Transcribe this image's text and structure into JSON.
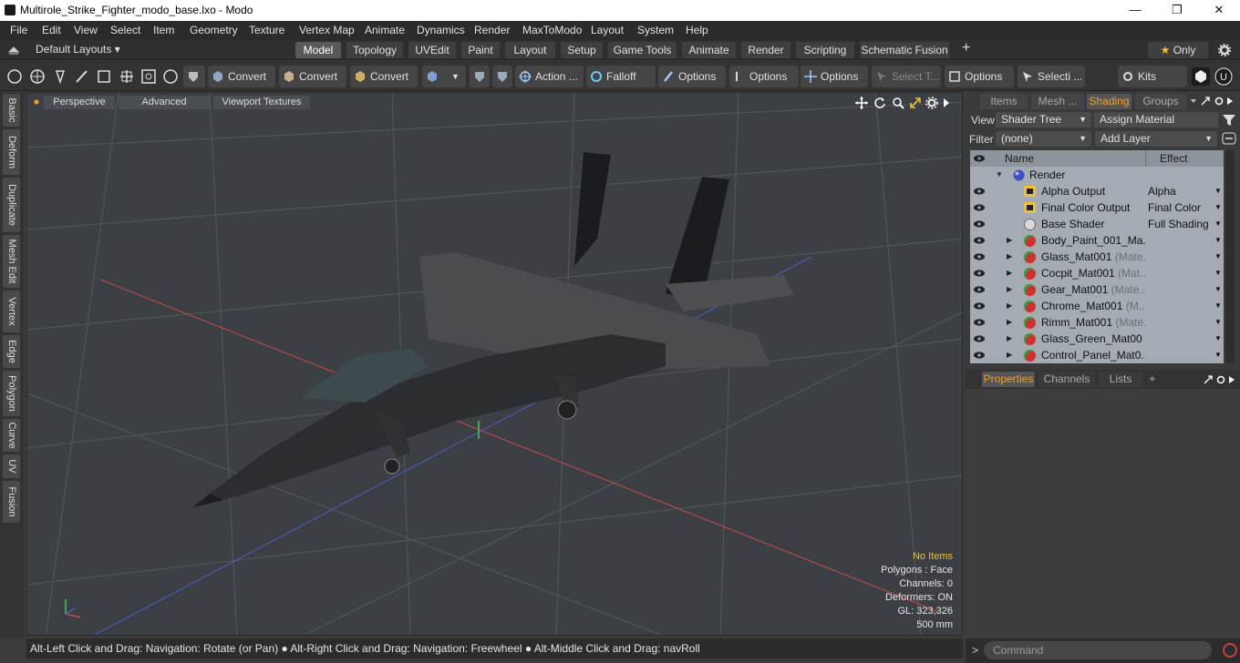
{
  "window": {
    "title": "Multirole_Strike_Fighter_modo_base.lxo - Modo",
    "minimize": "—",
    "maximize": "❐",
    "close": "✕"
  },
  "menu": [
    "File",
    "Edit",
    "View",
    "Select",
    "Item",
    "Geometry",
    "Texture",
    "Vertex Map",
    "Animate",
    "Dynamics",
    "Render",
    "MaxToModo",
    "Layout",
    "System",
    "Help"
  ],
  "layoutbar": {
    "layouts_label": "Default Layouts",
    "tabs": [
      "Model",
      "Topology",
      "UVEdit",
      "Paint",
      "Layout",
      "Setup",
      "Game Tools",
      "Animate",
      "Render",
      "Scripting",
      "Schematic Fusion"
    ],
    "active_tab": "Model",
    "plus": "+",
    "only_label": "Only",
    "star": "★"
  },
  "toolbar": {
    "convert1": "Convert",
    "convert2": "Convert",
    "convert3": "Convert",
    "action": "Action ...",
    "falloff": "Falloff",
    "options1": "Options",
    "options2": "Options",
    "options3": "Options",
    "select_t": "Select T...",
    "options4": "Options",
    "selecti": "Selecti ...",
    "kits": "Kits"
  },
  "lefttabs": [
    "Basic",
    "Deform",
    "Duplicate",
    "Mesh Edit",
    "Vertex",
    "Edge",
    "Polygon",
    "Curve",
    "UV",
    "Fusion"
  ],
  "viewport": {
    "perspective": "Perspective",
    "advanced": "Advanced",
    "textures": "Viewport Textures",
    "info": {
      "items": "No Items",
      "polygons": "Polygons : Face",
      "channels": "Channels: 0",
      "deformers": "Deformers: ON",
      "gl": "GL: 323,326",
      "scale": "500 mm"
    }
  },
  "status": "Alt-Left Click and Drag: Navigation: Rotate (or Pan) ● Alt-Right Click and Drag: Navigation: Freewheel ● Alt-Middle Click and Drag: navRoll",
  "rightpanel": {
    "tabs": [
      "Items",
      "Mesh ...",
      "Shading",
      "Groups"
    ],
    "active_tab": "Shading",
    "view_label": "View",
    "view_value": "Shader Tree",
    "assign_material": "Assign Material",
    "filter_label": "Filter",
    "filter_value": "(none)",
    "add_layer": "Add Layer",
    "col_name": "Name",
    "col_effect": "Effect",
    "rows": [
      {
        "name": "Render",
        "sub": "",
        "effect": ""
      },
      {
        "name": "Alpha Output",
        "sub": "",
        "effect": "Alpha"
      },
      {
        "name": "Final Color Output",
        "sub": "",
        "effect": "Final Color"
      },
      {
        "name": "Base Shader",
        "sub": "",
        "effect": "Full Shading"
      },
      {
        "name": "Body_Paint_001_Ma...",
        "sub": "",
        "effect": ""
      },
      {
        "name": "Glass_Mat001",
        "sub": " (Mate...",
        "effect": ""
      },
      {
        "name": "Cocpit_Mat001",
        "sub": " (Mat...",
        "effect": ""
      },
      {
        "name": "Gear_Mat001",
        "sub": " (Mate...",
        "effect": ""
      },
      {
        "name": "Chrome_Mat001",
        "sub": " (M...",
        "effect": ""
      },
      {
        "name": "Rimm_Mat001",
        "sub": " (Mate...",
        "effect": ""
      },
      {
        "name": "Glass_Green_Mat00 ...",
        "sub": "",
        "effect": ""
      },
      {
        "name": "Control_Panel_Mat0...",
        "sub": "",
        "effect": ""
      }
    ],
    "bottom_tabs": [
      "Properties",
      "Channels",
      "Lists"
    ],
    "bottom_active": "Properties",
    "plus": "+",
    "command_placeholder": "Command",
    "cmd_arrow": ">"
  },
  "colors": {
    "accent": "#f0a030",
    "viewport_bg": "#3c4044",
    "axis_x": "#c84a4a",
    "axis_z": "#4a5ec8",
    "axis_y": "#3ec85a"
  }
}
